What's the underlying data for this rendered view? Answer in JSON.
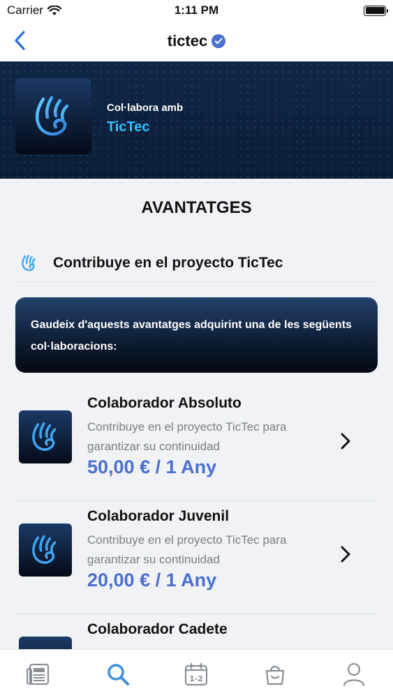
{
  "status_bar": {
    "carrier": "Carrier",
    "time": "1:11 PM"
  },
  "nav": {
    "title": "tictec"
  },
  "hero": {
    "subtitle": "Col·labora amb",
    "name": "TicTec"
  },
  "section": {
    "title": "AVANTATGES"
  },
  "project": {
    "label": "Contribuye en el proyecto TicTec"
  },
  "info": {
    "text": "Gaudeix d'aquests avantatges adquirint una de les següents col·laboracions:"
  },
  "plans": [
    {
      "name": "Colaborador Absoluto",
      "description": "Contribuye en el proyecto TicTec para garantizar su continuidad",
      "price": "50,00 € / 1 Any"
    },
    {
      "name": "Colaborador Juvenil",
      "description": "Contribuye en el proyecto TicTec para garantizar su continuidad",
      "price": "20,00 € / 1 Any"
    },
    {
      "name": "Colaborador Cadete",
      "description": "",
      "price": ""
    }
  ],
  "tabs": [
    "news-icon",
    "search-icon",
    "calendar-icon",
    "shop-icon",
    "profile-icon"
  ],
  "colors": {
    "accent": "#4a6fcf",
    "brand_cyan": "#35c2ff",
    "hero_bg": "#0d2340"
  }
}
